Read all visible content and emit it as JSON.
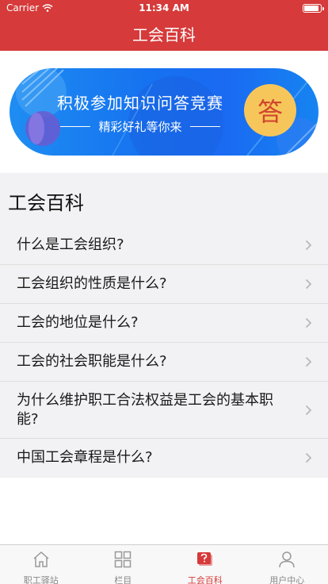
{
  "status_bar": {
    "carrier": "Carrier",
    "time": "11:34 AM",
    "battery_level": 0.9
  },
  "nav": {
    "title": "工会百科"
  },
  "banner": {
    "title": "积极参加知识问答竞赛",
    "subtitle": "精彩好礼等你来",
    "badge": "答"
  },
  "section": {
    "title": "工会百科"
  },
  "faq": [
    {
      "text": "什么是工会组织?"
    },
    {
      "text": "工会组织的性质是什么?"
    },
    {
      "text": "工会的地位是什么?"
    },
    {
      "text": "工会的社会职能是什么?"
    },
    {
      "text": "为什么维护职工合法权益是工会的基本职能?"
    },
    {
      "text": "中国工会章程是什么?"
    }
  ],
  "tabs": [
    {
      "label": "职工驿站",
      "icon": "home-icon"
    },
    {
      "label": "栏目",
      "icon": "grid-icon"
    },
    {
      "label": "工会百科",
      "icon": "question-icon",
      "active": true
    },
    {
      "label": "用户中心",
      "icon": "user-icon"
    }
  ],
  "colors": {
    "brand_red": "#d63a3a",
    "banner_blue": "#1672f0",
    "badge_yellow": "#f7c65a"
  }
}
